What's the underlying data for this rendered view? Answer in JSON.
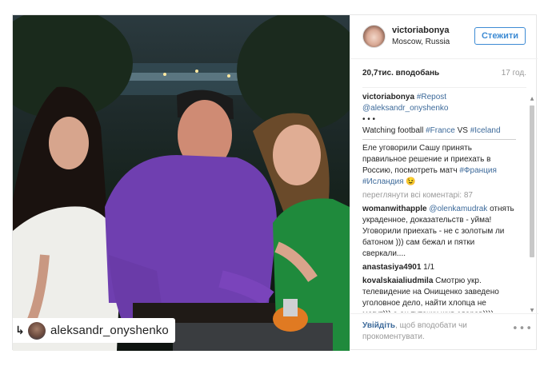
{
  "post": {
    "username": "victoriabonya",
    "location": "Moscow, Russia",
    "follow_label": "Стежити",
    "likes": "20,7тис. вподобань",
    "age": "17 год."
  },
  "photo": {
    "tag_prefix_icon": "repost-icon",
    "tagged_user": "aleksandr_onyshenko"
  },
  "caption": {
    "user": "victoriabonya",
    "repost_tag": "#Repost",
    "mention": "@aleksandr_onyshenko",
    "dots": "• • •",
    "line1": "Watching football ",
    "tag_france": "#France",
    "vs": " VS ",
    "tag_iceland": "#Iceland",
    "rule": "_______________________________",
    "ru_text": "Еле уговорили Сашу принять правильное решение и приехать в Россию, посмотреть матч ",
    "tag_franciya": "#Франция",
    "tag_islandiya": "#Исландия",
    "emoji": " 😉"
  },
  "view_all": "переглянути всі коментарі: 87",
  "comments": [
    {
      "user": "womanwithapple",
      "mention": "@olenkamudrak",
      "text": " отнять украденное, доказательств - уйма! Уговорили приехать - не с золотым ли батоном ))) сам бежал и пятки сверкали...."
    },
    {
      "user": "anastasiya4901",
      "mention": "",
      "text": " 1/1"
    },
    {
      "user": "kovalskaialiudmila",
      "mention": "",
      "text": " Смотрю укр. телевидение на Онищенко заведено уголовное дело, найти хлопца не могут))) а он туточки жив здоров))))"
    }
  ],
  "footer": {
    "login_link": "Увійдіть",
    "login_rest": ", щоб вподобати чи прокоментувати.",
    "more": "•••"
  },
  "colors": {
    "link": "#3d6a9a",
    "follow": "#3d8bd4",
    "muted": "#999999"
  }
}
